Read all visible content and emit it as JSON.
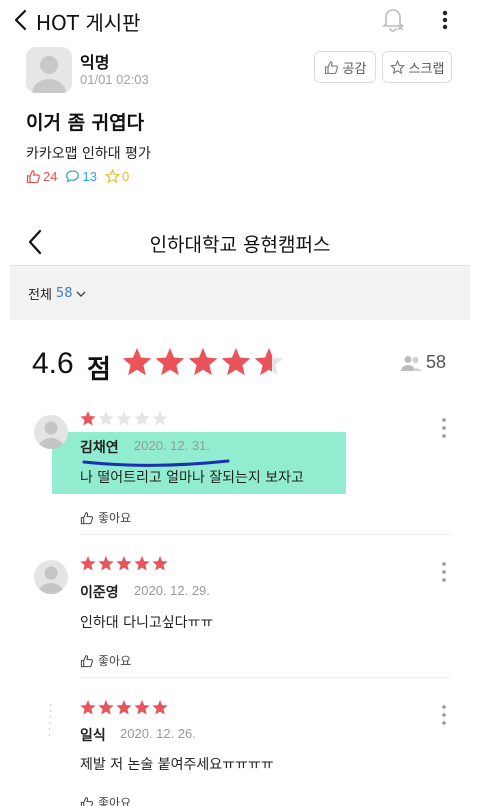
{
  "header": {
    "title": "HOT 게시판"
  },
  "post": {
    "author": "익명",
    "time": "01/01 02:03",
    "like_label": "공감",
    "scrap_label": "스크랩",
    "title": "이거 좀 귀엽다",
    "body": "카카오맵 인하대 평가",
    "stats": {
      "likes": "24",
      "comments": "13",
      "scraps": "0"
    }
  },
  "map": {
    "title": "인하대학교 용현캠퍼스",
    "filter_label": "전체",
    "filter_count": "58",
    "rating": "4.6",
    "rating_unit": "점",
    "rating_value": 4.6,
    "review_count": "58",
    "reviews": [
      {
        "stars": 1,
        "name": "김채연",
        "date": "2020. 12. 31.",
        "text": "나 떨어트리고 얼마나 잘되는지 보자고",
        "like_label": "좋아요"
      },
      {
        "stars": 5,
        "name": "이준영",
        "date": "2020. 12. 29.",
        "text": "인하대 다니고싶다ㅠㅠ",
        "like_label": "좋아요"
      },
      {
        "stars": 5,
        "name": "일식",
        "date": "2020. 12. 26.",
        "text": "제발 저 논술 붙여주세요ㅠㅠㅠㅠ",
        "like_label": "좋아요"
      }
    ]
  },
  "colors": {
    "star": "#e8545a",
    "star_empty": "#e5e5e5",
    "like_red": "#e0554f",
    "comment_blue": "#3aa0c8",
    "scrap_yellow": "#e6b91e",
    "highlight": "#7fe9c8",
    "underline": "#1c2fb0"
  }
}
